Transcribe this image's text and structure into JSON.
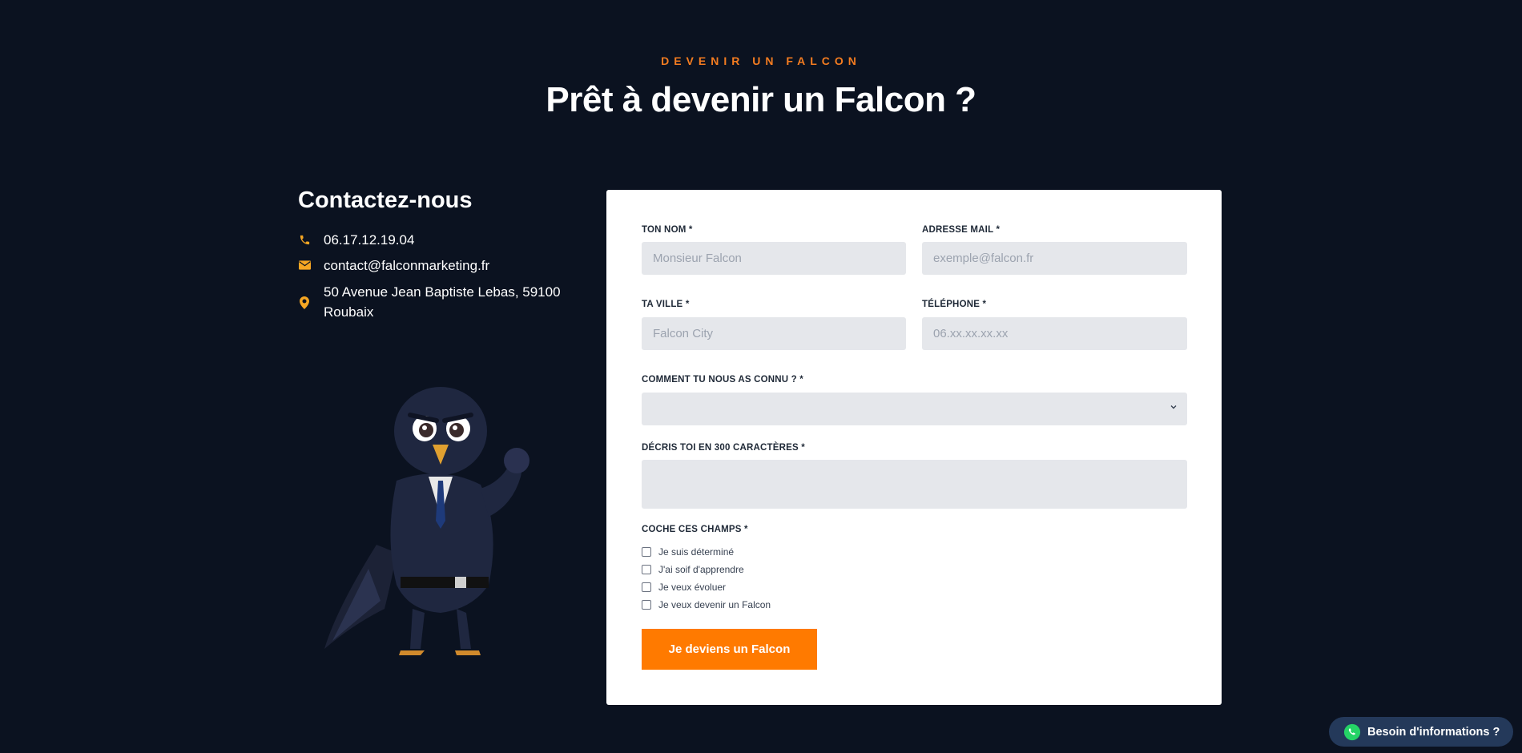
{
  "header": {
    "eyebrow": "DEVENIR UN FALCON",
    "title": "Prêt à devenir un Falcon ?"
  },
  "contact": {
    "title": "Contactez-nous",
    "phone": "06.17.12.19.04",
    "email": "contact@falconmarketing.fr",
    "address": "50 Avenue Jean Baptiste Lebas, 59100 Roubaix",
    "icons": [
      "phone-icon",
      "mail-icon",
      "location-pin-icon"
    ]
  },
  "form": {
    "name": {
      "label": "TON NOM *",
      "placeholder": "Monsieur Falcon",
      "value": ""
    },
    "email": {
      "label": "ADRESSE MAIL *",
      "placeholder": "exemple@falcon.fr",
      "value": ""
    },
    "city": {
      "label": "TA VILLE *",
      "placeholder": "Falcon City",
      "value": ""
    },
    "phone": {
      "label": "TÉLÉPHONE *",
      "placeholder": "06.xx.xx.xx.xx",
      "value": ""
    },
    "source": {
      "label": "COMMENT TU NOUS AS CONNU ? *",
      "selected": ""
    },
    "description": {
      "label": "DÉCRIS TOI EN 300 CARACTÈRES *",
      "value": ""
    },
    "checks": {
      "label": "COCHE CES CHAMPS *",
      "items": [
        "Je suis déterminé",
        "J'ai soif d'apprendre",
        "Je veux évoluer",
        "Je veux devenir un Falcon"
      ]
    },
    "submit_label": "Je deviens un Falcon"
  },
  "whatsapp": {
    "label": "Besoin d'informations ?"
  },
  "colors": {
    "background": "#0b1220",
    "accent": "#ff7a00",
    "icon_accent": "#f5a623",
    "field_bg": "#e5e7eb",
    "whatsapp_green": "#25d366",
    "pill_bg": "#24395a"
  }
}
